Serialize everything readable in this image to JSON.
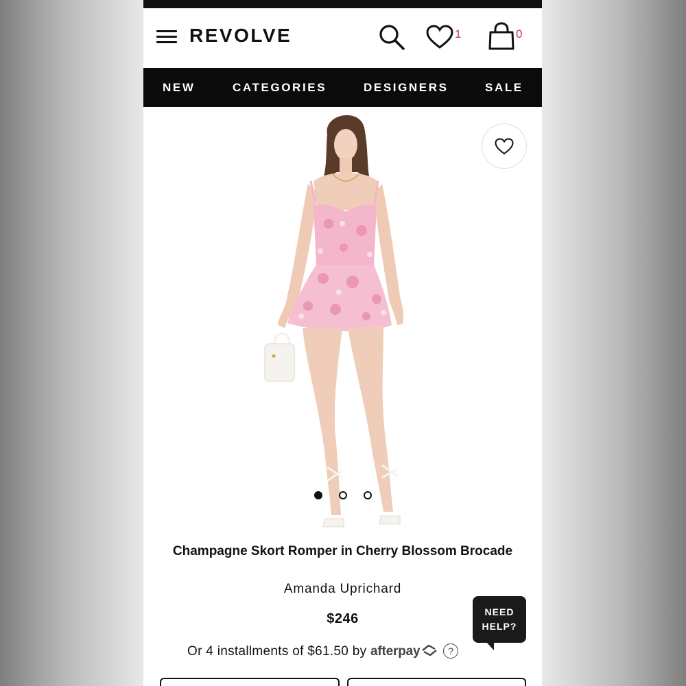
{
  "header": {
    "logo": "REVOLVE",
    "wishlist_count": "1",
    "bag_count": "0"
  },
  "nav": {
    "items": [
      "NEW",
      "CATEGORIES",
      "DESIGNERS",
      "SALE"
    ]
  },
  "gallery": {
    "image_count": 3,
    "active_index": 0
  },
  "product": {
    "title": "Champagne Skort Romper in Cherry Blossom Brocade",
    "brand": "Amanda Uprichard",
    "price": "$246",
    "installments_text": "Or 4 installments of $61.50 by",
    "afterpay_label": "afterpay",
    "help_mark": "?"
  },
  "help_widget": {
    "line1": "NEED",
    "line2": "HELP?"
  },
  "colors": {
    "accent": "#c2307a",
    "nav_bg": "#0b0b0b",
    "dress_pink": "#f3b6cb"
  }
}
